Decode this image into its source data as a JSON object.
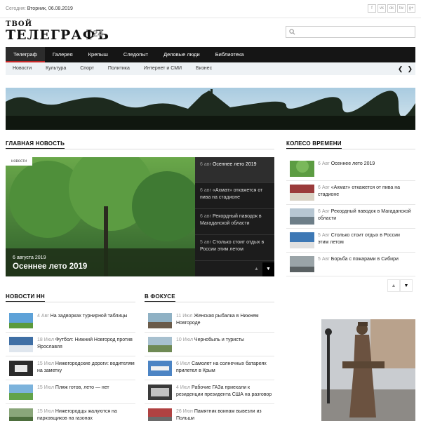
{
  "topbar": {
    "date_label": "Сегодня:",
    "date_value": "Вторник, 06.08.2019",
    "socials": [
      "f",
      "vk",
      "ok",
      "tw",
      "g+"
    ]
  },
  "logo": {
    "line1": "ТВОЙ",
    "line2": "ТЕЛЕГРАФЪ",
    "num": "24"
  },
  "search": {
    "placeholder": ""
  },
  "main_nav": [
    "Телеграф",
    "Галерея",
    "Крепыш",
    "Следопыт",
    "Деловые люди",
    "Библиотека"
  ],
  "sub_nav": [
    "Новости",
    "Культура",
    "Спорт",
    "Политика",
    "Интернет и СМИ",
    "Бизнес"
  ],
  "sections": {
    "main_news": "ГЛАВНАЯ НОВОСТЬ",
    "wheel": "КОЛЕСО ВРЕМЕНИ",
    "nn_news": "НОВОСТИ НН",
    "focus": "В ФОКУСЕ"
  },
  "featured": {
    "tag": "новости",
    "date": "6 августа 2019",
    "title": "Осеннее лето 2019",
    "items": [
      {
        "date": "6 авг",
        "title": "Осеннее лето 2019"
      },
      {
        "date": "6 авг",
        "title": "«Ахмат» откажется от пива на стадионе"
      },
      {
        "date": "6 авг",
        "title": "Рекордный паводок в Магаданской области"
      },
      {
        "date": "5 авг",
        "title": "Столько стоит отдых в России этим летом"
      }
    ]
  },
  "wheel": [
    {
      "date": "6 Авг",
      "title": "Осеннее лето 2019"
    },
    {
      "date": "6 Авг",
      "title": "«Ахмат» откажется от пива на стадионе"
    },
    {
      "date": "6 Авг",
      "title": "Рекордный паводок в Магаданской области"
    },
    {
      "date": "5 Авг",
      "title": "Столько стоит отдых в России этим летом"
    },
    {
      "date": "5 Авг",
      "title": "Борьба с пожарами в Сибири"
    }
  ],
  "nn_news": [
    {
      "date": "4 Авг",
      "title": "На задворках турнирной таблицы"
    },
    {
      "date": "18 Июл",
      "title": "Футбол: Нижний Новгород против Ярославля"
    },
    {
      "date": "15 Июл",
      "title": "Нижегородские дороги: водителям на заметку"
    },
    {
      "date": "15 Июл",
      "title": "Пляж готов, лето — нет"
    },
    {
      "date": "15 Июл",
      "title": "Нижегородцы жалуются на парковщиков на газонах"
    }
  ],
  "focus": [
    {
      "date": "11 Июл",
      "title": "Женская рыбалка в Нижнем Новгороде"
    },
    {
      "date": "10 Июл",
      "title": "Чернобыль и туристы"
    },
    {
      "date": "6 Июл",
      "title": "Самолет на солнечных батареях прилетел в Крым"
    },
    {
      "date": "4 Июл",
      "title": "Рабочие ГАЗа приехали к резиденции президента США на разговор"
    },
    {
      "date": "26 Июн",
      "title": "Памятник воинам вывезли из Польши"
    }
  ],
  "colors": {
    "nav_bg": "#151515",
    "accent": "#c62828",
    "subnav_bg": "#eef2f5"
  }
}
